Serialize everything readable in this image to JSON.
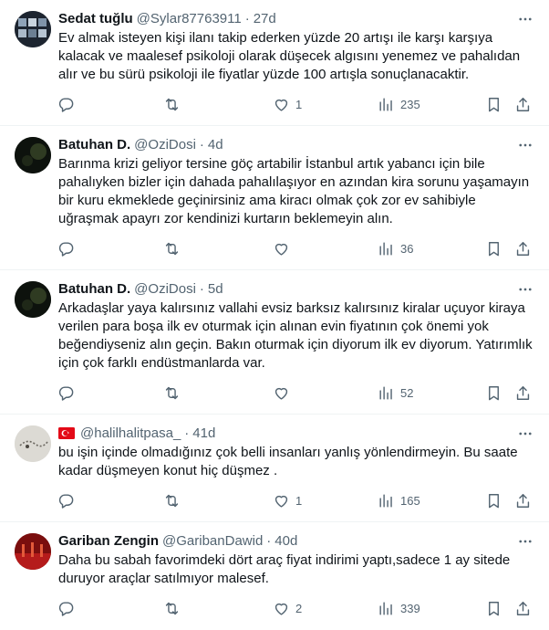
{
  "tweets": [
    {
      "name": "Sedat tuğlu",
      "handle": "@Sylar87763911",
      "dot": "·",
      "time": "27d",
      "text": "Ev almak isteyen kişi ilanı takip ederken yüzde 20 artışı ile karşı karşıya kalacak ve maalesef psikoloji olarak düşecek algısını yenemez ve pahalıdan alır ve bu sürü psikoloji ile fiyatlar yüzde 100 artışla sonuçlanacaktir.",
      "likes": "1",
      "views": "235"
    },
    {
      "name": "Batuhan D.",
      "handle": "@OziDosi",
      "dot": "·",
      "time": "4d",
      "text": "Barınma krizi geliyor tersine göç artabilir İstanbul artık yabancı için bile pahalıyken bizler için dahada pahalılaşıyor en azından kira sorunu yaşamayın bir kuru ekmeklede geçinirsiniz ama kiracı olmak çok zor ev sahibiyle uğraşmak apayrı zor kendinizi kurtarın beklemeyin alın.",
      "likes": "",
      "views": "36"
    },
    {
      "name": "Batuhan D.",
      "handle": "@OziDosi",
      "dot": "·",
      "time": "5d",
      "text": "Arkadaşlar yaya kalırsınız vallahi evsiz barksız kalırsınız kiralar uçuyor kiraya verilen para boşa ilk ev oturmak için alınan evin fiyatının çok önemi yok beğendiyseniz alın geçin. Bakın oturmak için diyorum ilk ev diyorum. Yatırımlık için çok farklı endüstmanlarda var.",
      "likes": "",
      "views": "52"
    },
    {
      "name": "",
      "handle": "@halilhalitpasa_",
      "dot": "·",
      "time": "41d",
      "text": "bu işin içinde olmadığınız çok belli insanları yanlış yönlendirmeyin. Bu saate kadar düşmeyen konut hiç düşmez .",
      "likes": "1",
      "views": "165"
    },
    {
      "name": "Gariban Zengin",
      "handle": "@GaribanDawid",
      "dot": "·",
      "time": "40d",
      "text": "Daha bu sabah favorimdeki dört araç fiyat indirimi yaptı,sadece 1 ay sitede duruyor araçlar satılmıyor malesef.",
      "likes": "2",
      "views": "339"
    }
  ],
  "icons": {
    "avatar_1": "photo-collage-avatar",
    "avatar_2": "dark-avatar",
    "avatar_3": "dark-avatar",
    "avatar_4": "prayer-beads-avatar",
    "avatar_5": "red-avatar",
    "flag": "turkey-flag-icon"
  },
  "colors": {
    "text": "#0f1419",
    "secondary": "#536471",
    "divider": "#eff3f4",
    "turkey_flag": "#e30a17"
  }
}
